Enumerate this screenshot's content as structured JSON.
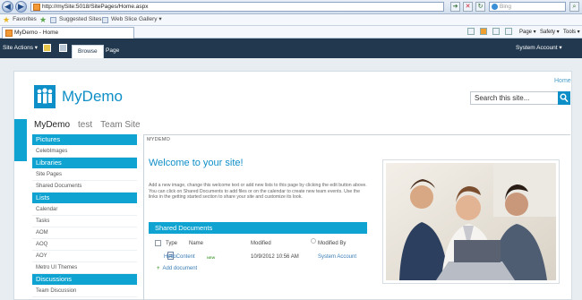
{
  "browser": {
    "address": "http://mySite:5018/SitePages/Home.aspx",
    "search_placeholder": "Bing",
    "favorites_label": "Favorites",
    "favorites_items": [
      "Suggested Sites ▾",
      "Web Slice Gallery ▾"
    ],
    "tab_title": "MyDemo - Home",
    "commands": [
      "Page ▾",
      "Safety ▾",
      "Tools ▾"
    ]
  },
  "ribbon": {
    "site_actions": "Site Actions ▾",
    "tabs": [
      "Browse",
      "Page"
    ],
    "user": "System Account ▾"
  },
  "header": {
    "home_link": "Home",
    "site_title": "MyDemo",
    "search_placeholder": "Search this site..."
  },
  "topnav": [
    "MyDemo",
    "test",
    "Team Site"
  ],
  "quicklaunch": [
    {
      "heading": "Pictures",
      "items": [
        "CelebImages"
      ]
    },
    {
      "heading": "Libraries",
      "items": [
        "Site Pages",
        "Shared Documents"
      ]
    },
    {
      "heading": "Lists",
      "items": [
        "Calendar",
        "Tasks",
        "AOM",
        "AOQ",
        "AOY",
        "Metro UI Themes"
      ]
    },
    {
      "heading": "Discussions",
      "items": [
        "Team Discussion"
      ]
    }
  ],
  "content": {
    "breadcrumb": "MYDEMO",
    "welcome_title": "Welcome to your site!",
    "intro": "Add a new image, change this welcome text or add new lists to this page by clicking the edit button above. You can click on Shared Documents to add files or on the calendar to create new team events. Use the links in the getting started section to share your site and customize its look.",
    "docs_title": "Shared Documents",
    "columns": [
      "Type",
      "Name",
      "Modified",
      "Modified By"
    ],
    "rows": [
      {
        "name": "HelloContent",
        "badge": "NEW",
        "modified": "10/9/2012 10:56 AM",
        "modified_by": "System Account"
      }
    ],
    "add_document": "Add document"
  },
  "colors": {
    "accent": "#0fa3d1",
    "ribbon": "#21384e",
    "title": "#0f8fc7"
  }
}
